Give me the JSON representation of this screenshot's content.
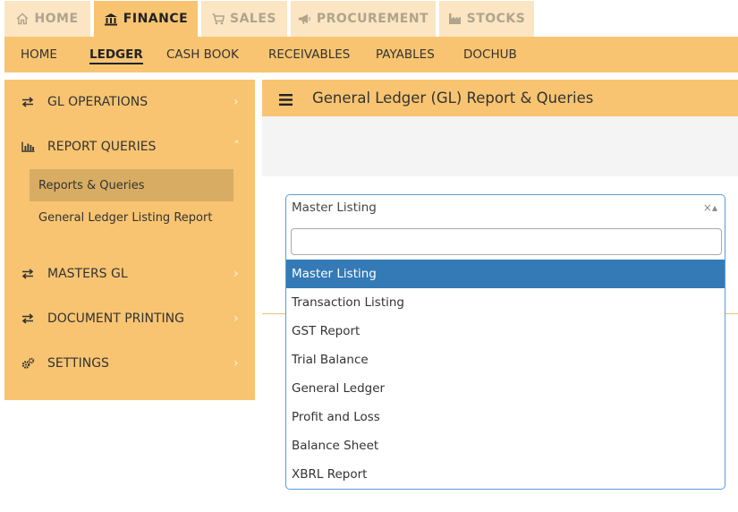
{
  "top_tabs": [
    {
      "label": "HOME",
      "icon": "home-icon",
      "active": false
    },
    {
      "label": "FINANCE",
      "icon": "bank-icon",
      "active": true
    },
    {
      "label": "SALES",
      "icon": "cart-icon",
      "active": false
    },
    {
      "label": "PROCUREMENT",
      "icon": "megaphone-icon",
      "active": false
    },
    {
      "label": "STOCKS",
      "icon": "factory-icon",
      "active": false
    }
  ],
  "subnav": {
    "items": [
      "HOME",
      "LEDGER",
      "CASH BOOK",
      "RECEIVABLES",
      "PAYABLES",
      "DOCHUB"
    ],
    "active": "LEDGER"
  },
  "sidebar": {
    "items": [
      {
        "label": "GL OPERATIONS",
        "icon": "exchange-icon",
        "chevron": "›"
      },
      {
        "label": "REPORT QUERIES",
        "icon": "bar-chart-icon",
        "chevron": "˄"
      },
      {
        "label": "MASTERS GL",
        "icon": "exchange-icon",
        "chevron": "›"
      },
      {
        "label": "DOCUMENT PRINTING",
        "icon": "exchange-icon",
        "chevron": "›"
      },
      {
        "label": "SETTINGS",
        "icon": "gears-icon",
        "chevron": "›"
      }
    ],
    "subitems": [
      {
        "label": "Reports & Queries",
        "active": true
      },
      {
        "label": "General Ledger Listing Report",
        "active": false
      }
    ]
  },
  "panel": {
    "title": "General Ledger (GL) Report & Queries"
  },
  "select": {
    "value": "Master Listing",
    "clear_glyph": "×▴",
    "search_value": "",
    "options": [
      "Master Listing",
      "Transaction Listing",
      "GST Report",
      "Trial Balance",
      "General Ledger",
      "Profit and Loss",
      "Balance Sheet",
      "XBRL Report"
    ],
    "highlighted": "Master Listing"
  },
  "colors": {
    "accent": "#f8c471",
    "tab_inactive": "#fbe5c3",
    "highlight": "#337ab7",
    "sidebar_active": "#d8ad63"
  }
}
